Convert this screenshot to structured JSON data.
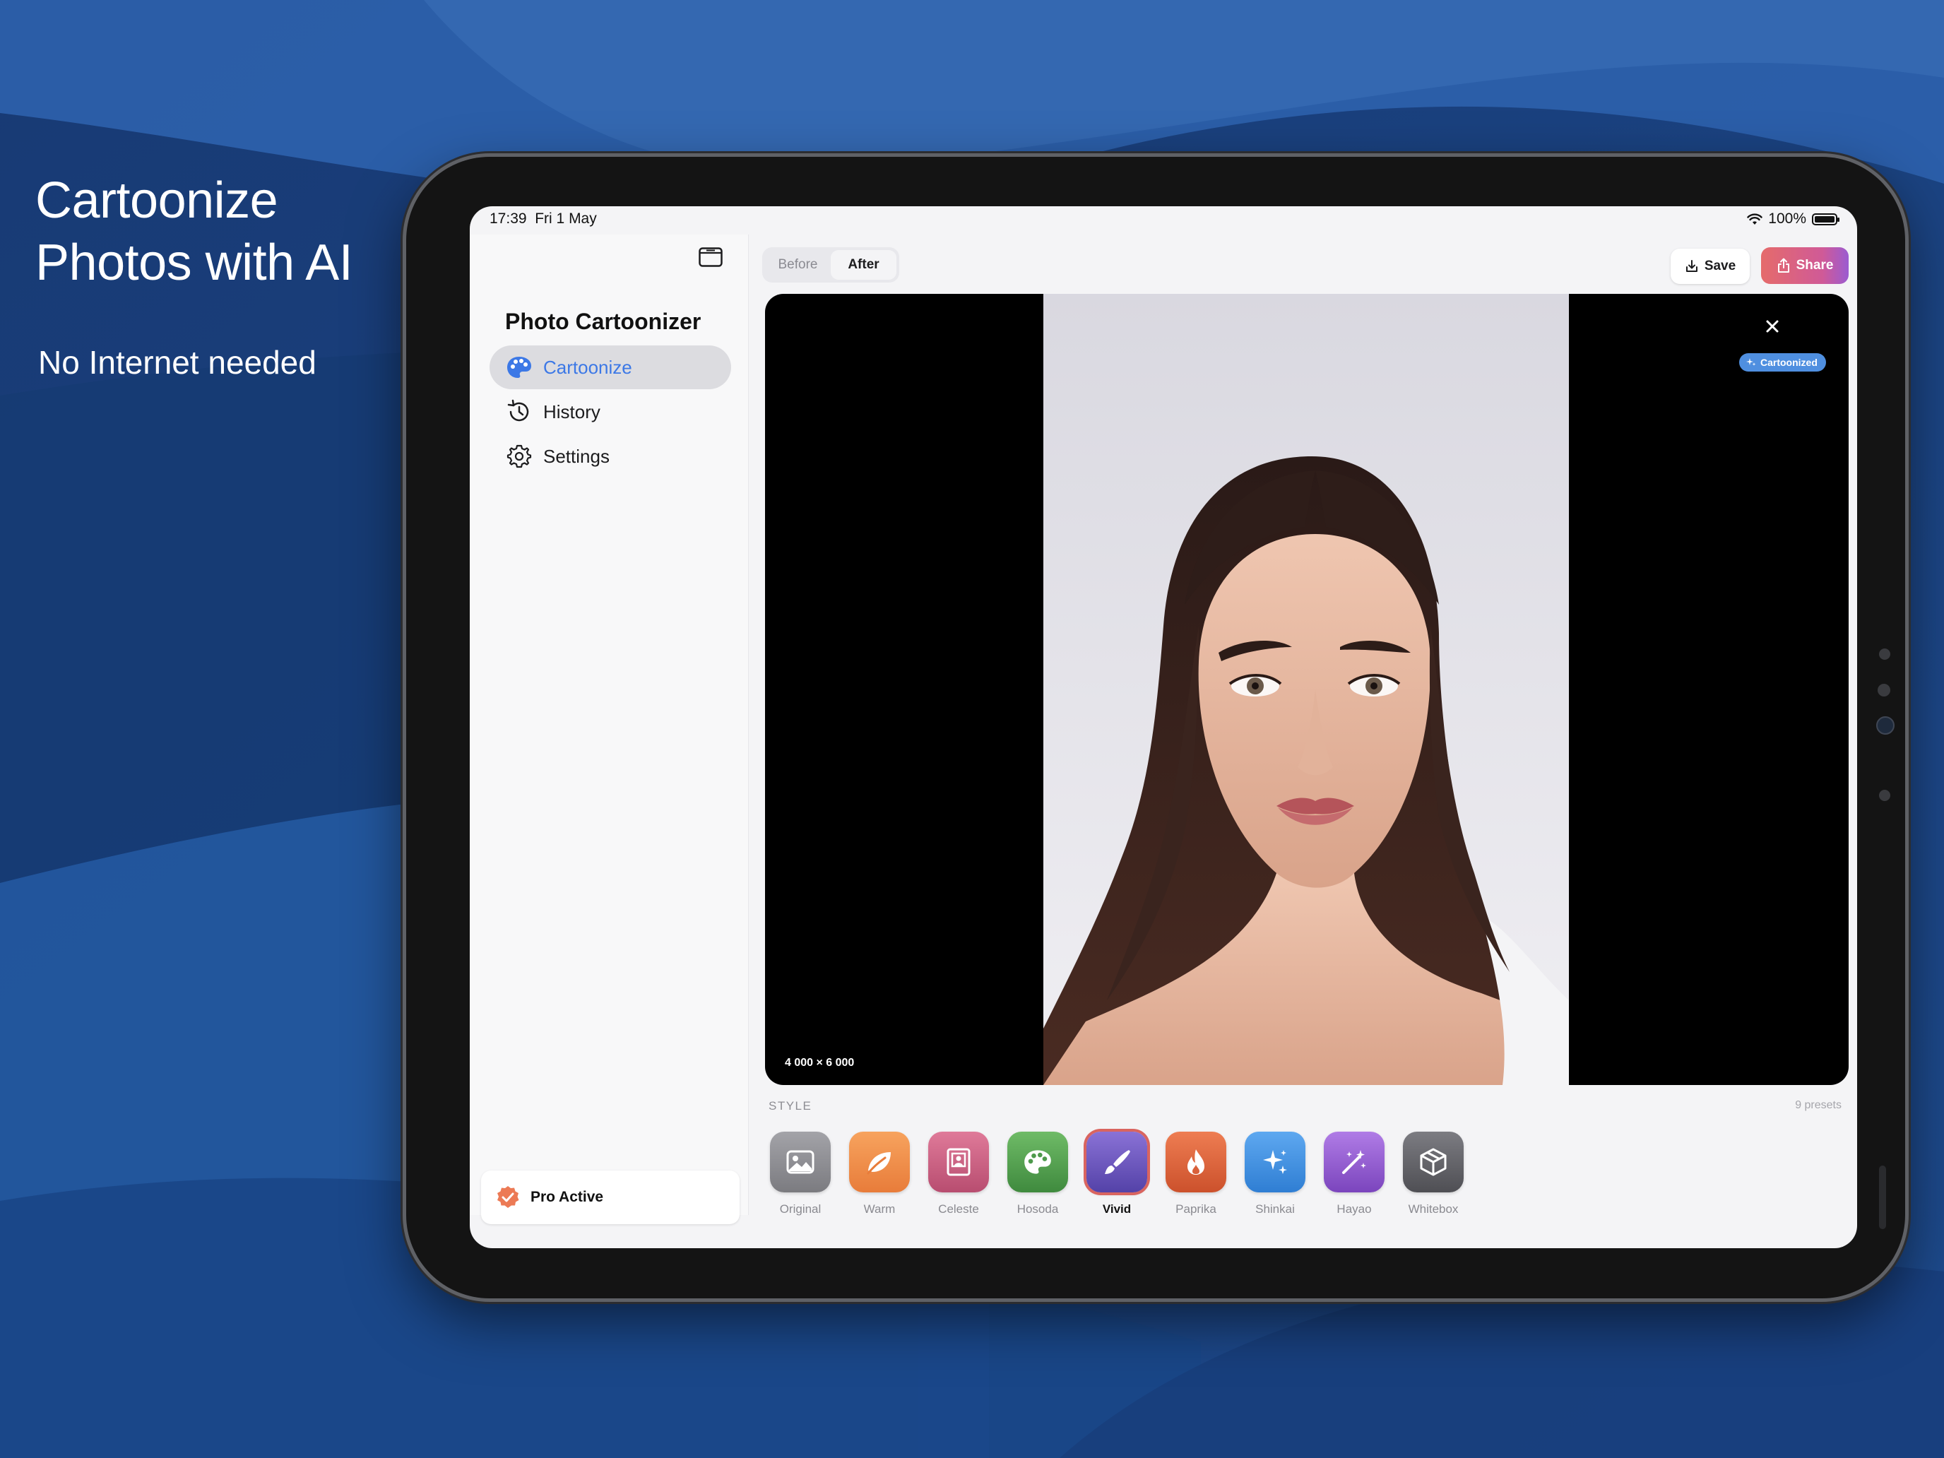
{
  "promo": {
    "title_line1": "Cartoonize",
    "title_line2": "Photos with AI",
    "subtitle": "No Internet needed"
  },
  "status_bar": {
    "time": "17:39",
    "date": "Fri 1 May",
    "battery": "100%"
  },
  "sidebar": {
    "app_title": "Photo Cartoonizer",
    "items": [
      {
        "label": "Cartoonize",
        "icon": "palette-icon",
        "active": true
      },
      {
        "label": "History",
        "icon": "clock-icon",
        "active": false
      },
      {
        "label": "Settings",
        "icon": "gear-icon",
        "active": false
      }
    ],
    "pro_status": "Pro Active"
  },
  "toolbar": {
    "before_label": "Before",
    "after_label": "After",
    "selected": "After",
    "save_label": "Save",
    "share_label": "Share"
  },
  "viewer": {
    "badge": "Cartoonized",
    "dimensions": "4 000 × 6 000"
  },
  "styles": {
    "section_label": "STYLE",
    "count_label": "9 presets",
    "selected": "Vivid",
    "presets": [
      {
        "name": "Original",
        "icon": "image-icon",
        "color": "#8a8a8f"
      },
      {
        "name": "Warm",
        "icon": "leaf-icon",
        "color": "#ef8a44"
      },
      {
        "name": "Celeste",
        "icon": "portrait-frame-icon",
        "color": "#c4587a"
      },
      {
        "name": "Hosoda",
        "icon": "palette-icon",
        "color": "#4e9a4c"
      },
      {
        "name": "Vivid",
        "icon": "paintbrush-icon",
        "color": "#6652b8"
      },
      {
        "name": "Paprika",
        "icon": "flame-icon",
        "color": "#d9603a"
      },
      {
        "name": "Shinkai",
        "icon": "sparkles-icon",
        "color": "#3f8fe0"
      },
      {
        "name": "Hayao",
        "icon": "magic-wand-icon",
        "color": "#9457cf"
      },
      {
        "name": "Whitebox",
        "icon": "cube-icon",
        "color": "#5e5e63"
      }
    ]
  },
  "colors": {
    "accent": "#3c78e6",
    "selected_ring": "#d9645f",
    "badge": "#4f8fe0"
  }
}
